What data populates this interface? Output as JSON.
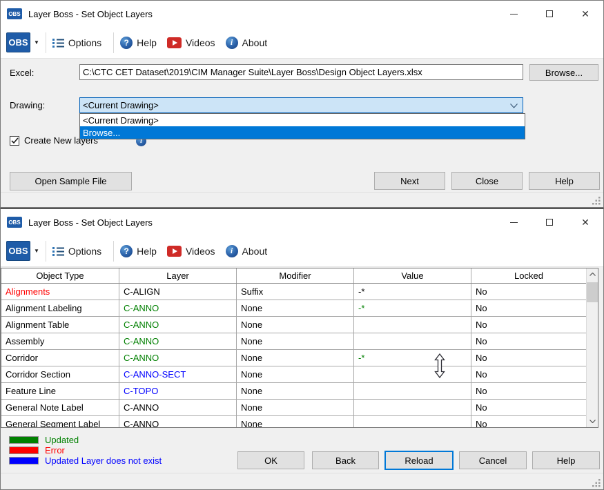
{
  "colors": {
    "accent": "#0078d7",
    "logo_blue": "#1f5ca8",
    "combo_fill": "#cce4f7",
    "status_green": "#008000",
    "status_red": "#ff0000",
    "status_blue": "#0000ff"
  },
  "toolbar": {
    "logo": "OBS",
    "options": "Options",
    "help": "Help",
    "videos": "Videos",
    "about": "About"
  },
  "window1": {
    "title": "Layer Boss - Set Object Layers",
    "excel": {
      "label": "Excel:",
      "value": "C:\\CTC CET Dataset\\2019\\CIM Manager Suite\\Layer Boss\\Design Object Layers.xlsx",
      "browse_label": "Browse..."
    },
    "drawing": {
      "label": "Drawing:",
      "value": "<Current Drawing>",
      "items": [
        "<Current Drawing>",
        "Browse..."
      ],
      "selected_index": 1
    },
    "create_new_layers": {
      "label": "Create New layers",
      "checked": true
    },
    "buttons": {
      "open_sample": "Open Sample File",
      "next": "Next",
      "close": "Close",
      "help": "Help"
    }
  },
  "window2": {
    "title": "Layer Boss - Set Object Layers",
    "table": {
      "columns": [
        "Object Type",
        "Layer",
        "Modifier",
        "Value",
        "Locked"
      ],
      "rows": [
        {
          "cells": [
            {
              "t": "Alignments",
              "c": "#ff0000"
            },
            {
              "t": "C-ALIGN",
              "c": "#000000"
            },
            {
              "t": "Suffix",
              "c": "#000000"
            },
            {
              "t": "-*",
              "c": "#000000"
            },
            {
              "t": "No",
              "c": "#000000"
            }
          ]
        },
        {
          "cells": [
            {
              "t": "Alignment Labeling",
              "c": "#000000"
            },
            {
              "t": "C-ANNO",
              "c": "#008000"
            },
            {
              "t": "None",
              "c": "#000000"
            },
            {
              "t": "-*",
              "c": "#008000"
            },
            {
              "t": "No",
              "c": "#000000"
            }
          ]
        },
        {
          "cells": [
            {
              "t": "Alignment Table",
              "c": "#000000"
            },
            {
              "t": "C-ANNO",
              "c": "#008000"
            },
            {
              "t": "None",
              "c": "#000000"
            },
            {
              "t": "",
              "c": "#000000"
            },
            {
              "t": "No",
              "c": "#000000"
            }
          ]
        },
        {
          "cells": [
            {
              "t": "Assembly",
              "c": "#000000"
            },
            {
              "t": "C-ANNO",
              "c": "#008000"
            },
            {
              "t": "None",
              "c": "#000000"
            },
            {
              "t": "",
              "c": "#000000"
            },
            {
              "t": "No",
              "c": "#000000"
            }
          ]
        },
        {
          "cells": [
            {
              "t": "Corridor",
              "c": "#000000"
            },
            {
              "t": "C-ANNO",
              "c": "#008000"
            },
            {
              "t": "None",
              "c": "#000000"
            },
            {
              "t": "-*",
              "c": "#008000"
            },
            {
              "t": "No",
              "c": "#000000"
            }
          ]
        },
        {
          "cells": [
            {
              "t": "Corridor Section",
              "c": "#000000"
            },
            {
              "t": "C-ANNO-SECT",
              "c": "#0000ff"
            },
            {
              "t": "None",
              "c": "#000000"
            },
            {
              "t": "",
              "c": "#000000"
            },
            {
              "t": "No",
              "c": "#000000"
            }
          ]
        },
        {
          "cells": [
            {
              "t": "Feature Line",
              "c": "#000000"
            },
            {
              "t": "C-TOPO",
              "c": "#0000ff"
            },
            {
              "t": "None",
              "c": "#000000"
            },
            {
              "t": "",
              "c": "#000000"
            },
            {
              "t": "No",
              "c": "#000000"
            }
          ]
        },
        {
          "cells": [
            {
              "t": "General Note Label",
              "c": "#000000"
            },
            {
              "t": "C-ANNO",
              "c": "#000000"
            },
            {
              "t": "None",
              "c": "#000000"
            },
            {
              "t": "",
              "c": "#000000"
            },
            {
              "t": "No",
              "c": "#000000"
            }
          ]
        },
        {
          "cells": [
            {
              "t": "General Segment Label",
              "c": "#000000"
            },
            {
              "t": "C-ANNO",
              "c": "#000000"
            },
            {
              "t": "None",
              "c": "#000000"
            },
            {
              "t": "",
              "c": "#000000"
            },
            {
              "t": "No",
              "c": "#000000"
            }
          ]
        }
      ]
    },
    "legend": [
      {
        "color": "#008000",
        "label": "Updated"
      },
      {
        "color": "#ff0000",
        "label": "Error"
      },
      {
        "color": "#0000ff",
        "label": "Updated Layer does not exist"
      }
    ],
    "buttons": {
      "ok": "OK",
      "back": "Back",
      "reload": "Reload",
      "cancel": "Cancel",
      "help": "Help"
    }
  }
}
